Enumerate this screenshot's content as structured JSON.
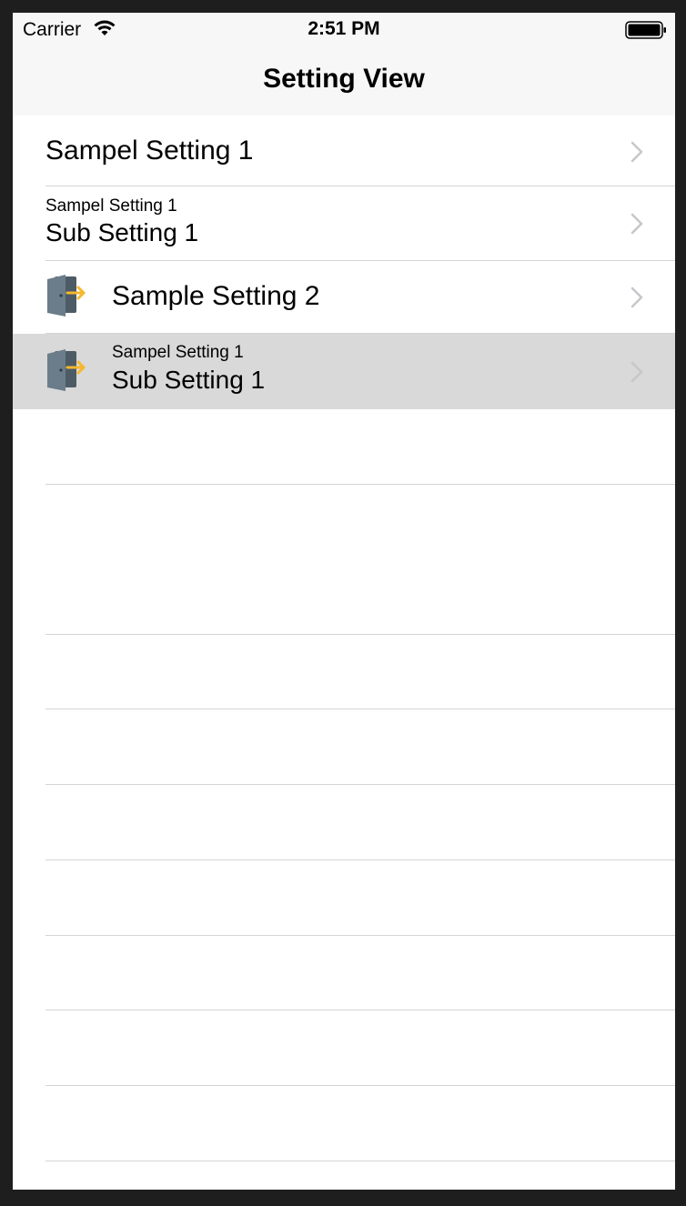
{
  "status_bar": {
    "carrier": "Carrier",
    "time": "2:51 PM",
    "wifi_icon": "wifi-icon",
    "battery_icon": "battery-icon"
  },
  "nav_bar": {
    "title": "Setting View"
  },
  "table": {
    "rows": [
      {
        "title": "Sampel Setting 1",
        "subtitle": "",
        "icon": "",
        "selected": false
      },
      {
        "title": "Sub Setting 1",
        "subtitle": "Sampel Setting 1",
        "icon": "",
        "selected": false
      },
      {
        "title": "Sample Setting 2",
        "subtitle": "",
        "icon": "door-exit-icon",
        "selected": false
      },
      {
        "title": "Sub Setting 1",
        "subtitle": "Sampel Setting 1",
        "icon": "door-exit-icon",
        "selected": true
      }
    ]
  },
  "colors": {
    "background": "#1e1e1e",
    "bar_background": "#f7f7f7",
    "selected_row": "#d9d9d9",
    "separator": "#d4d4d4",
    "chevron": "#c7c7cc",
    "door_body": "#5a6b77",
    "arrow": "#f5b82e"
  }
}
